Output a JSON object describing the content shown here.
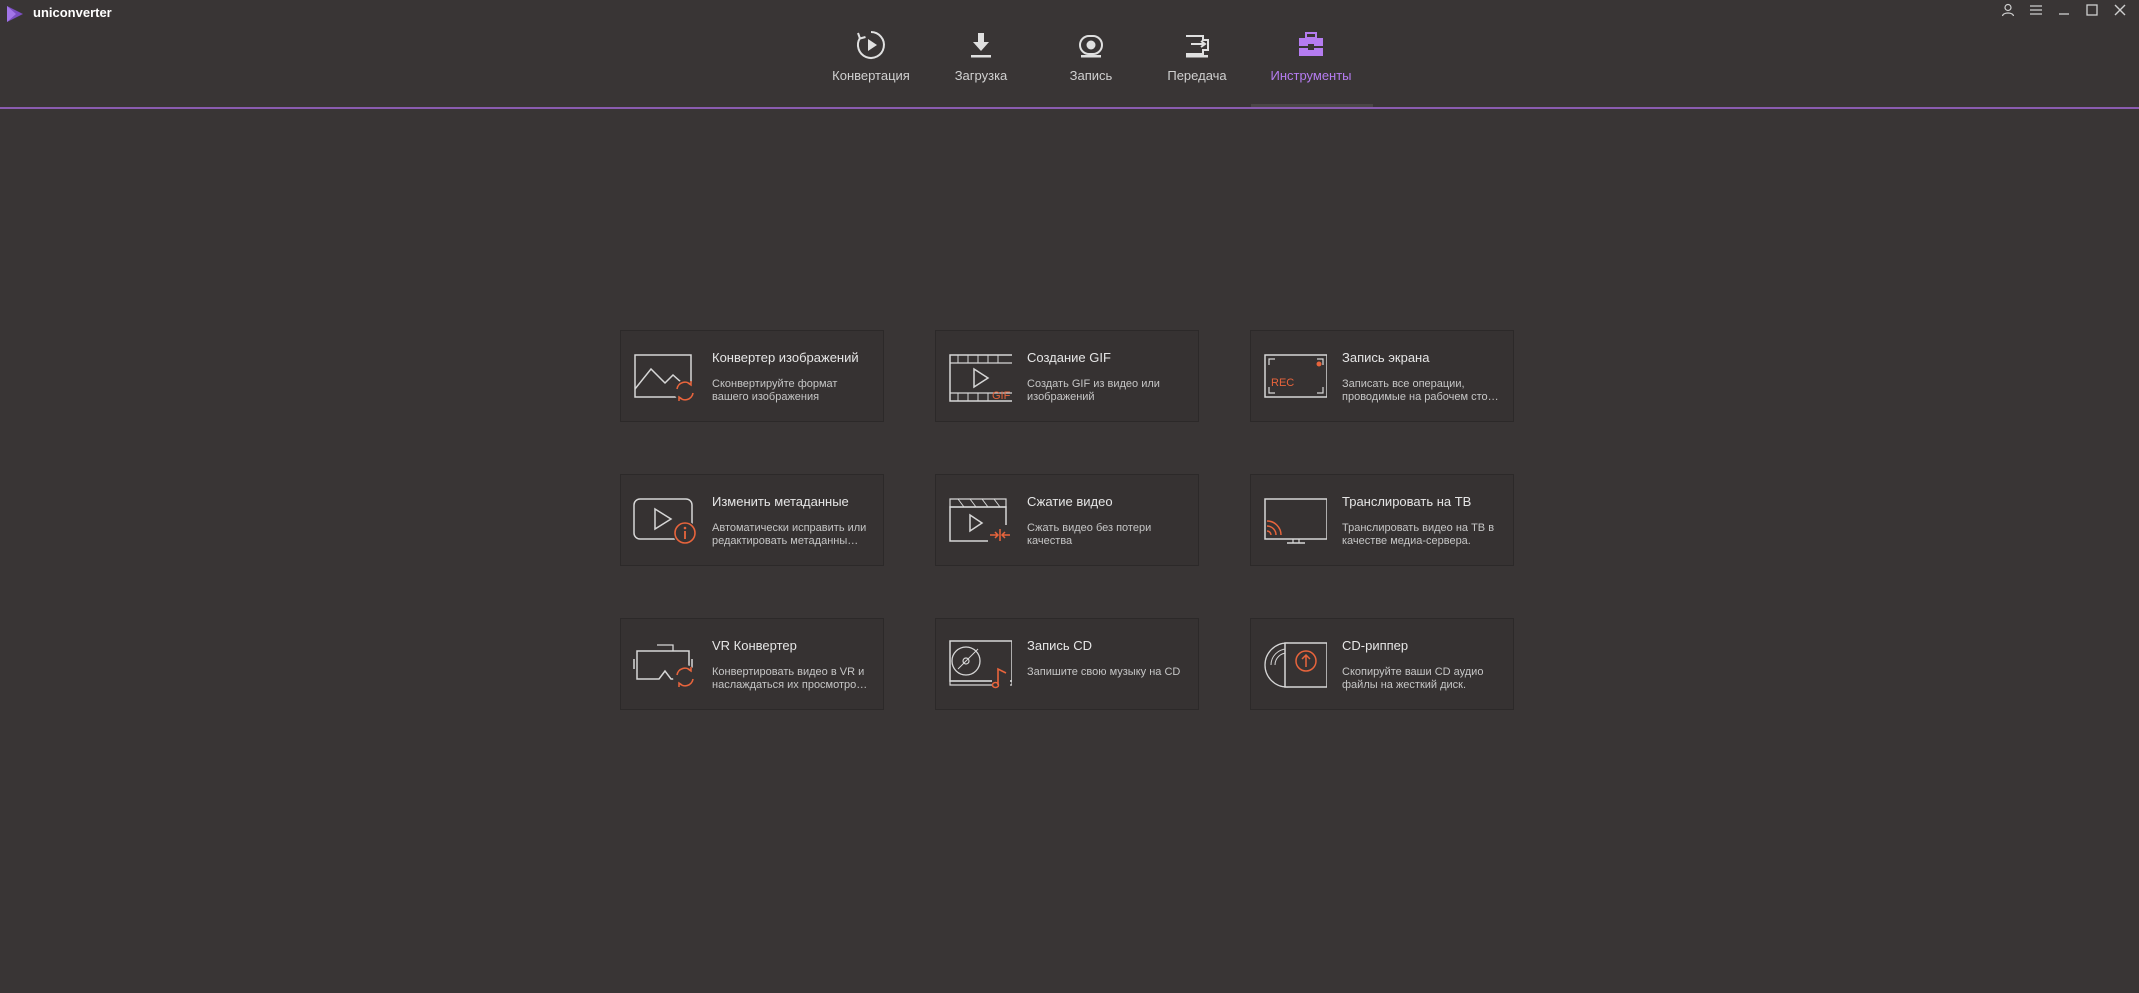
{
  "app": {
    "title": "uniconverter",
    "accent_color": "#b57cf0",
    "icon_accent_color": "#e8643c"
  },
  "window_controls": [
    {
      "name": "account-icon"
    },
    {
      "name": "menu-icon"
    },
    {
      "name": "minimize-icon"
    },
    {
      "name": "maximize-icon"
    },
    {
      "name": "close-icon"
    }
  ],
  "nav": {
    "tabs": [
      {
        "label": "Конвертация",
        "icon": "convert-icon",
        "active": false
      },
      {
        "label": "Загрузка",
        "icon": "download-icon",
        "active": false
      },
      {
        "label": "Запись",
        "icon": "record-icon",
        "active": false
      },
      {
        "label": "Передача",
        "icon": "transfer-icon",
        "active": false
      },
      {
        "label": "Инструменты",
        "icon": "toolbox-icon",
        "active": true
      }
    ]
  },
  "tools": [
    {
      "title": "Конвертер изображений",
      "desc": "Сконвертируйте формат вашего изображения",
      "icon": "image-convert-icon"
    },
    {
      "title": "Создание GIF",
      "desc": "Создать GIF из видео или изображений",
      "icon": "gif-icon"
    },
    {
      "title": "Запись экрана",
      "desc": "Записать все операции, проводимые на рабочем сто…",
      "icon": "screen-record-icon"
    },
    {
      "title": "Изменить метаданные",
      "desc": "Автоматически исправить или редактировать метаданны…",
      "icon": "metadata-icon"
    },
    {
      "title": "Сжатие видео",
      "desc": "Сжать видео без потери качества",
      "icon": "compress-icon"
    },
    {
      "title": "Транслировать на ТВ",
      "desc": "Транслировать видео на ТВ в качестве медиа-сервера.",
      "icon": "cast-tv-icon"
    },
    {
      "title": "VR Конвертер",
      "desc": "Конвертировать видео в VR и наслаждаться их просмотро…",
      "icon": "vr-icon"
    },
    {
      "title": "Запись CD",
      "desc": "Запишите свою музыку на CD",
      "icon": "cd-burn-icon"
    },
    {
      "title": "CD-риппер",
      "desc": "Скопируйте ваши CD аудио файлы на жесткий диск.",
      "icon": "cd-ripper-icon"
    }
  ]
}
